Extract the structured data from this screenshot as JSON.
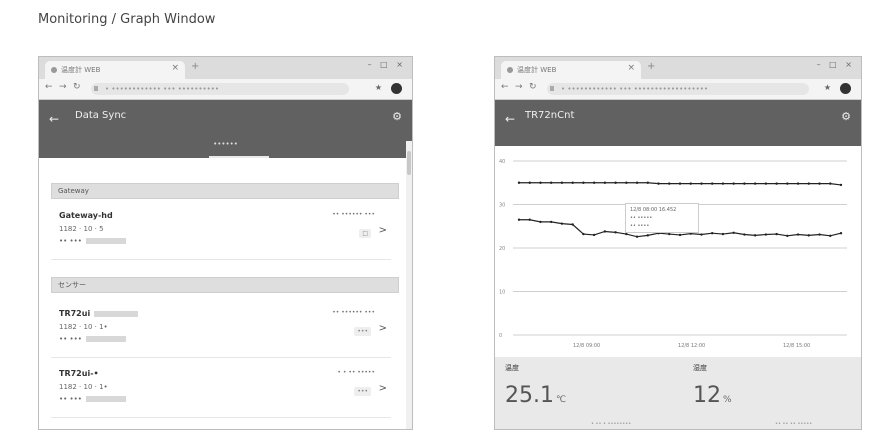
{
  "page": {
    "title": "Monitoring / Graph Window"
  },
  "left": {
    "browser": {
      "tab_title": "温度計 WEB",
      "tab_close": "×",
      "new_tab": "+",
      "window_controls": "– □ ×",
      "back": "←",
      "forward": "→",
      "reload": "↻",
      "url": "• •••••••••••• ••• ••••••••••",
      "ext": "★"
    },
    "appbar": {
      "back": "←",
      "title": "Data Sync",
      "settings": "⚙",
      "tab_label": "••••••"
    },
    "sections": [
      {
        "label": "Gateway"
      },
      {
        "label": "センサー"
      }
    ],
    "rows": [
      {
        "name": "Gateway-hd",
        "line1": "1182 · 10 · 5",
        "line2": "•• •••",
        "status": "•• •••••• •••",
        "badge": "□",
        "chevron": ">"
      },
      {
        "name": "TR72ui",
        "line1": "1182 · 10 · 1•",
        "line2": "•• •••",
        "status": "•• •••••• •••",
        "badge": "•••",
        "chevron": ">"
      },
      {
        "name": "TR72ui-•",
        "line1": "1182 · 10 · 1•",
        "line2": "•• •••",
        "status": "• • •• •••••",
        "badge": "•••",
        "chevron": ">"
      }
    ]
  },
  "right": {
    "browser": {
      "tab_title": "温度計 WEB",
      "tab_close": "×",
      "new_tab": "+",
      "window_controls": "– □ ×",
      "back": "←",
      "forward": "→",
      "reload": "↻",
      "url": "• •••••••••••• ••• ••••••••••••••••••",
      "ext": "★"
    },
    "appbar": {
      "back": "←",
      "title": "TR72nCnt",
      "settings": "⚙"
    },
    "tooltip": [
      "12/8 08:00 16.452",
      "•• •••••",
      "•• ••••"
    ],
    "stats": [
      {
        "label": "温度",
        "value": "25.1",
        "unit": "℃",
        "foot": "• •• • ••••••••"
      },
      {
        "label": "湿度",
        "value": "12",
        "unit": "%",
        "foot": "•• •• •• •••••"
      }
    ]
  },
  "colors": {
    "appbar": "#616161",
    "line": "#222222",
    "grid": "#cfcfcf"
  },
  "chart_data": {
    "type": "line",
    "x_tick_labels": [
      "12/8 09:00",
      "12/8 12:00",
      "12/8 15:00"
    ],
    "y_tick_labels": [
      "40",
      "30",
      "20",
      "10",
      "0"
    ],
    "ylim": [
      0,
      40
    ],
    "series": [
      {
        "values": [
          35,
          35,
          35,
          35,
          35,
          35,
          35,
          35,
          35,
          35,
          35,
          35,
          35,
          34.8,
          34.8,
          34.8,
          34.8,
          34.8,
          34.8,
          34.8,
          34.8,
          34.8,
          34.8,
          34.8,
          34.8,
          34.8,
          34.8,
          34.8,
          34.8,
          34.8,
          34.5
        ]
      },
      {
        "values": [
          26.5,
          26.5,
          26,
          26,
          25.6,
          25.4,
          23.2,
          23,
          23.8,
          23.6,
          23.2,
          22.6,
          22.9,
          23.4,
          23.2,
          23,
          23.3,
          23.1,
          23.4,
          23.2,
          23.5,
          23.1,
          22.9,
          23.1,
          23.2,
          22.8,
          23.1,
          22.9,
          23.1,
          22.8,
          23.4
        ]
      }
    ]
  }
}
